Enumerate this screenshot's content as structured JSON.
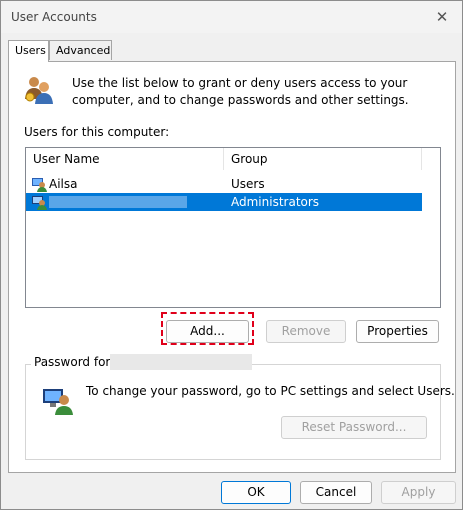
{
  "window": {
    "title": "User Accounts",
    "close_glyph": "✕"
  },
  "tabs": [
    {
      "label": "Users",
      "active": true
    },
    {
      "label": "Advanced",
      "active": false
    }
  ],
  "info": {
    "text": "Use the list below to grant or deny users access to your computer, and to change passwords and other settings.",
    "icon": "users-icon"
  },
  "users_list": {
    "label": "Users for this computer:",
    "columns": [
      "User Name",
      "Group"
    ],
    "rows": [
      {
        "name": "Ailsa",
        "group": "Users",
        "selected": false
      },
      {
        "name": "",
        "group": "Administrators",
        "selected": true
      }
    ]
  },
  "list_buttons": {
    "add": "Add...",
    "remove": "Remove",
    "properties": "Properties"
  },
  "password": {
    "label": "Password for",
    "text": "To change your password, go to PC settings and select Users.",
    "reset_button": "Reset Password..."
  },
  "dialog_buttons": {
    "ok": "OK",
    "cancel": "Cancel",
    "apply": "Apply"
  },
  "colors": {
    "selection": "#0078d7",
    "highlight": "#e0001b"
  }
}
